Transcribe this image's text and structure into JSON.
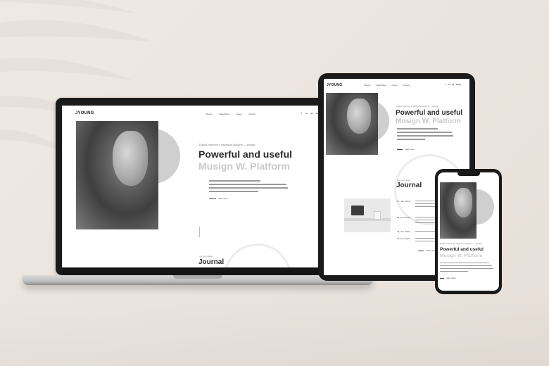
{
  "site": {
    "logo": "YOUNG",
    "nav": [
      "Musign",
      "Capabilities",
      "Cases",
      "Contact"
    ],
    "social": [
      "f",
      "in",
      "◎",
      "blog"
    ],
    "tagline": "Digital experience integrated platform — musign",
    "headline": "Powerful and useful",
    "subheadline": "Musign W. Platform",
    "read_more": "read more",
    "journal_sub": "our your ideas",
    "journal_title": "Journal",
    "journal_dates": [
      "17, Jan. 2019",
      "08, Nov. 2018",
      "25, Oct. 2018",
      "07, Oct. 2018"
    ]
  },
  "colors": {
    "background": "#ece5df",
    "device_frame": "#1a1a1a",
    "headline": "#2b2b2b",
    "subheadline": "#c9c9c9"
  }
}
